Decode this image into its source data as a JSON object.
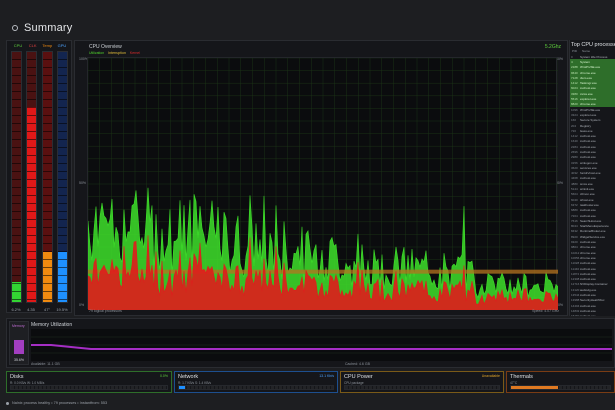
{
  "header": {
    "title": "Summary",
    "icon": "summary-icon"
  },
  "meters": {
    "labels": [
      "CPU",
      "CLK",
      "Temp",
      "GPU"
    ],
    "values": [
      "6.2%",
      "4.35",
      "47°",
      "19.5%"
    ],
    "levels": [
      0.08,
      0.78,
      0.2,
      0.2
    ],
    "colors": [
      "#33d433",
      "#e01818",
      "#f08a10",
      "#1e90ff"
    ],
    "track_colors": [
      "#4a1212",
      "#4a1212",
      "#5a1010",
      "#13254f"
    ]
  },
  "overview": {
    "title": "CPU Overview",
    "legend": [
      {
        "label": "Utilization",
        "color": "#4fd32c"
      },
      {
        "label": "Interruption",
        "color": "#e8c33a"
      },
      {
        "label": "Kernel",
        "color": "#e02c2c"
      }
    ],
    "perf_value": "5.2Ghz",
    "axis": {
      "top": "100%",
      "mid": "50%",
      "bottom": "0%"
    },
    "footer_left": "79 logical processors",
    "footer_right": "Speed: 4.07 GHz",
    "colors": {
      "utilization": "#3ee02a",
      "kernel": "#e01c1c",
      "threshold": "#b5721f",
      "grid": "#1e3a18"
    }
  },
  "processes": {
    "title": "Top CPU processes",
    "header": [
      "PID",
      "Name"
    ],
    "rows": [
      {
        "pid": "0",
        "name": "System Idle Process",
        "hi": false
      },
      {
        "pid": "4",
        "name": "System",
        "hi": true
      },
      {
        "pid": "2188",
        "name": "WmiPrvSE.exe",
        "hi": true
      },
      {
        "pid": "9640",
        "name": "chrome.exe",
        "hi": true
      },
      {
        "pid": "7128",
        "name": "dwm.exe",
        "hi": true
      },
      {
        "pid": "1412",
        "name": "Taskmgr.exe",
        "hi": true
      },
      {
        "pid": "6024",
        "name": "svchost.exe",
        "hi": true
      },
      {
        "pid": "3380",
        "name": "csrss.exe",
        "hi": true
      },
      {
        "pid": "5516",
        "name": "explorer.exe",
        "hi": true
      },
      {
        "pid": "8820",
        "name": "chrome.exe",
        "hi": true
      },
      {
        "pid": "1096",
        "name": "WmiPrvSE.exe",
        "hi": false
      },
      {
        "pid": "3324",
        "name": "explorer.exe",
        "hi": false
      },
      {
        "pid": "160",
        "name": "Secure System",
        "hi": false
      },
      {
        "pid": "204",
        "name": "Registry",
        "hi": false
      },
      {
        "pid": "720",
        "name": "lsass.exe",
        "hi": false
      },
      {
        "pid": "1412",
        "name": "svchost.exe",
        "hi": false
      },
      {
        "pid": "1640",
        "name": "svchost.exe",
        "hi": false
      },
      {
        "pid": "2284",
        "name": "svchost.exe",
        "hi": false
      },
      {
        "pid": "2696",
        "name": "svchost.exe",
        "hi": false
      },
      {
        "pid": "2980",
        "name": "svchost.exe",
        "hi": false
      },
      {
        "pid": "3156",
        "name": "winlogon.exe",
        "hi": false
      },
      {
        "pid": "3620",
        "name": "services.exe",
        "hi": false
      },
      {
        "pid": "4032",
        "name": "fontdrvhost.exe",
        "hi": false
      },
      {
        "pid": "4468",
        "name": "svchost.exe",
        "hi": false
      },
      {
        "pid": "4880",
        "name": "smss.exe",
        "hi": false
      },
      {
        "pid": "5144",
        "name": "wininit.exe",
        "hi": false
      },
      {
        "pid": "5604",
        "name": "ctfmon.exe",
        "hi": false
      },
      {
        "pid": "6040",
        "name": "sihost.exe",
        "hi": false
      },
      {
        "pid": "6372",
        "name": "taskhostw.exe",
        "hi": false
      },
      {
        "pid": "6880",
        "name": "svchost.exe",
        "hi": false
      },
      {
        "pid": "7204",
        "name": "svchost.exe",
        "hi": false
      },
      {
        "pid": "7616",
        "name": "SearchHost.exe",
        "hi": false
      },
      {
        "pid": "8044",
        "name": "StartMenuExperience",
        "hi": false
      },
      {
        "pid": "8432",
        "name": "RuntimeBroker.exe",
        "hi": false
      },
      {
        "pid": "8920",
        "name": "WidgetService.exe",
        "hi": false
      },
      {
        "pid": "9320",
        "name": "svchost.exe",
        "hi": false
      },
      {
        "pid": "9804",
        "name": "chrome.exe",
        "hi": false
      },
      {
        "pid": "10212",
        "name": "chrome.exe",
        "hi": false
      },
      {
        "pid": "10656",
        "name": "chrome.exe",
        "hi": false
      },
      {
        "pid": "11028",
        "name": "svchost.exe",
        "hi": false
      },
      {
        "pid": "11440",
        "name": "svchost.exe",
        "hi": false
      },
      {
        "pid": "11872",
        "name": "svchost.exe",
        "hi": false
      },
      {
        "pid": "12308",
        "name": "svchost.exe",
        "hi": false
      },
      {
        "pid": "12716",
        "name": "NVDisplay.Container",
        "hi": false
      },
      {
        "pid": "13120",
        "name": "audiodg.exe",
        "hi": false
      },
      {
        "pid": "13544",
        "name": "svchost.exe",
        "hi": false
      },
      {
        "pid": "13988",
        "name": "SecurityHealthSvc",
        "hi": false
      },
      {
        "pid": "14404",
        "name": "svchost.exe",
        "hi": false
      },
      {
        "pid": "14832",
        "name": "svchost.exe",
        "hi": false
      },
      {
        "pid": "15260",
        "name": "svchost.exe",
        "hi": false
      }
    ]
  },
  "memory": {
    "tile_label": "Memory",
    "tile_value": "35.6%",
    "tile_level": 0.36,
    "title": "Memory Utilization",
    "footer_left": "Available: 11.1 GB",
    "footer_mid": "Cached: 4.6 GB",
    "line_color": "#a52ec4"
  },
  "panels": {
    "disks": {
      "title": "Disks",
      "sub": "R: 0.0 KB/s  W: 1.0 MB/s",
      "right": "0.0%",
      "right_color": "#5fd23d",
      "fill": 0.0,
      "color": "#2aa52a",
      "border": "#2e6e2a"
    },
    "network": {
      "title": "Network",
      "sub": "R: 1.7 KB/s  S: 1.4 KB/s",
      "right": "13.1 Kb/s",
      "right_color": "#4da3ff",
      "fill": 0.04,
      "color": "#1e90ff",
      "border": "#1d4f8f"
    },
    "gpu": {
      "title": "CPU Power",
      "sub": "CPU package",
      "right": "Unavailable",
      "right_color": "#e0a52a",
      "fill": 0.0,
      "color": "#e0a52a",
      "border": "#7a5a18"
    },
    "thermals": {
      "title": "Thermals",
      "sub": "47°C",
      "right": "",
      "right_color": "#e07a22",
      "fill": 0.47,
      "color": "#e07a22",
      "border": "#7a3c14"
    }
  },
  "status": {
    "text": "Nalnix process healthy  •  79 processes  •  Instantfrom: 553"
  }
}
